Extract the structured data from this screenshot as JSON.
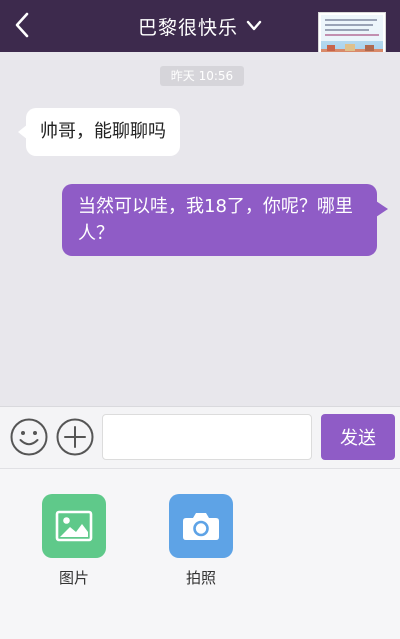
{
  "header": {
    "title": "巴黎很快乐",
    "back_icon": "chevron-left-icon",
    "dropdown_icon": "chevron-down-icon",
    "background_color": "#3d2a4d"
  },
  "chat": {
    "timestamp": "昨天 10:56",
    "messages": [
      {
        "direction": "incoming",
        "text": "帅哥，能聊聊吗"
      },
      {
        "direction": "outgoing",
        "text": "当然可以哇，我18了，你呢？哪里人？"
      }
    ],
    "outgoing_color": "#8f5cc6",
    "incoming_color": "#ffffff"
  },
  "input_bar": {
    "emoji_icon": "smiley-icon",
    "plus_icon": "plus-circle-icon",
    "input_value": "",
    "send_label": "发送"
  },
  "tools": [
    {
      "label": "图片",
      "icon": "image-icon",
      "color": "#5fc98a"
    },
    {
      "label": "拍照",
      "icon": "camera-icon",
      "color": "#5ea3e6"
    }
  ]
}
